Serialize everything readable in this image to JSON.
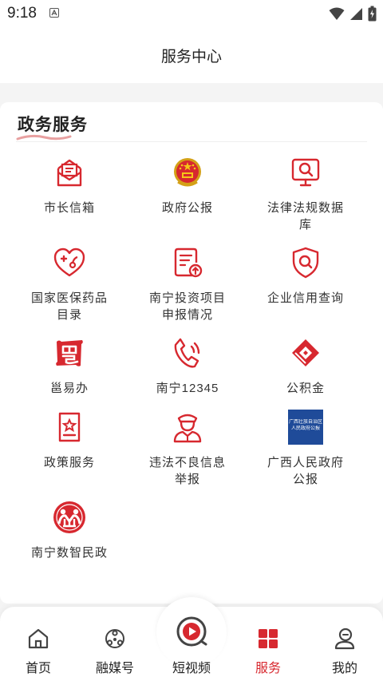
{
  "status_bar": {
    "time": "9:18"
  },
  "header": {
    "title": "服务中心"
  },
  "section": {
    "title": "政务服务"
  },
  "services": [
    {
      "label": "市长信箱",
      "icon": "mail-icon"
    },
    {
      "label": "政府公报",
      "icon": "national-emblem-icon"
    },
    {
      "label": "法律法规数据库",
      "icon": "monitor-search-icon"
    },
    {
      "label": "国家医保药品目录",
      "icon": "heart-plus-icon"
    },
    {
      "label": "南宁投资项目申报情况",
      "icon": "document-upload-icon"
    },
    {
      "label": "企业信用查询",
      "icon": "shield-search-icon"
    },
    {
      "label": "邕易办",
      "icon": "yong-logo-icon"
    },
    {
      "label": "南宁12345",
      "icon": "phone-call-icon"
    },
    {
      "label": "公积金",
      "icon": "housing-fund-icon"
    },
    {
      "label": "政策服务",
      "icon": "policy-document-icon"
    },
    {
      "label": "违法不良信息举报",
      "icon": "police-officer-icon"
    },
    {
      "label": "广西人民政府公报",
      "icon": "gazette-cover-icon"
    },
    {
      "label": "南宁数智民政",
      "icon": "civil-affairs-logo-icon"
    }
  ],
  "gazette_cover_text": [
    "广西壮族自治区",
    "人民政府公报"
  ],
  "tabbar": {
    "active": "服务",
    "items": [
      {
        "label": "首页",
        "icon": "home-icon"
      },
      {
        "label": "融媒号",
        "icon": "media-network-icon"
      },
      {
        "label": "短视频",
        "icon": "video-play-icon"
      },
      {
        "label": "服务",
        "icon": "services-grid-icon"
      },
      {
        "label": "我的",
        "icon": "profile-icon"
      }
    ]
  },
  "colors": {
    "accent": "#d7282f",
    "background": "#f4f4f4",
    "card": "#ffffff"
  }
}
